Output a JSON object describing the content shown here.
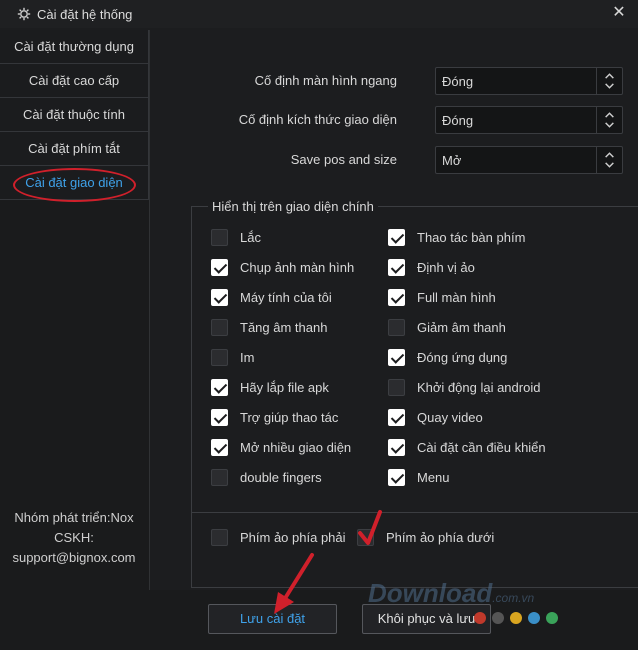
{
  "window": {
    "title": "Cài đặt hệ thống",
    "close_glyph": "✕"
  },
  "sidebar": {
    "items": [
      {
        "label": "Cài đặt thường dụng"
      },
      {
        "label": "Cài đặt cao cấp"
      },
      {
        "label": "Cài đặt thuộc tính"
      },
      {
        "label": "Cài đặt phím tắt"
      },
      {
        "label": "Cài đặt giao diện",
        "active": true
      }
    ],
    "footer": {
      "line1": "Nhóm phát triển:Nox",
      "line2": "CSKH:",
      "line3": "support@bignox.com"
    }
  },
  "settings": {
    "rows": [
      {
        "label": "Cố định màn hình ngang",
        "value": "Đóng"
      },
      {
        "label": "Cố định kích thức giao diện",
        "value": "Đóng"
      },
      {
        "label": "Save pos and size",
        "value": "Mở"
      }
    ]
  },
  "display_group": {
    "title": "Hiển thị trên giao diện chính",
    "left": [
      {
        "label": "Lắc",
        "checked": false
      },
      {
        "label": "Chụp ảnh màn hình",
        "checked": true
      },
      {
        "label": "Máy tính của tôi",
        "checked": true
      },
      {
        "label": "Tăng âm thanh",
        "checked": false
      },
      {
        "label": "Im",
        "checked": false
      },
      {
        "label": "Hãy lắp file apk",
        "checked": true
      },
      {
        "label": "Trợ giúp thao tác",
        "checked": true
      },
      {
        "label": "Mở nhiều giao diện",
        "checked": true
      },
      {
        "label": "double fingers",
        "checked": false
      }
    ],
    "right": [
      {
        "label": "Thao tác bàn phím",
        "checked": true
      },
      {
        "label": "Định vị ảo",
        "checked": true
      },
      {
        "label": "Full màn hình",
        "checked": true
      },
      {
        "label": "Giảm âm thanh",
        "checked": false
      },
      {
        "label": "Đóng ứng dụng",
        "checked": true
      },
      {
        "label": "Khởi động lại android",
        "checked": false
      },
      {
        "label": "Quay video",
        "checked": true
      },
      {
        "label": "Cài đặt cần điều khiển",
        "checked": true
      },
      {
        "label": "Menu",
        "checked": true
      }
    ],
    "bottom": [
      {
        "label": "Phím ảo phía phải",
        "checked": false
      },
      {
        "label": "Phím ảo phía dưới",
        "checked": false
      }
    ]
  },
  "buttons": {
    "save": "Lưu cài đặt",
    "restore": "Khôi phục và lưu"
  },
  "watermark": {
    "text": "Download",
    "suffix": ".com.vn",
    "dot_colors": [
      "#c0392b",
      "#555555",
      "#d9a520",
      "#3a8fc7",
      "#3aa35a"
    ]
  },
  "colors": {
    "accent": "#3fa2ea",
    "annotation": "#d0202b"
  },
  "icons": {
    "title": "gear-icon",
    "select_arrow": "chevron-updown-icon"
  }
}
